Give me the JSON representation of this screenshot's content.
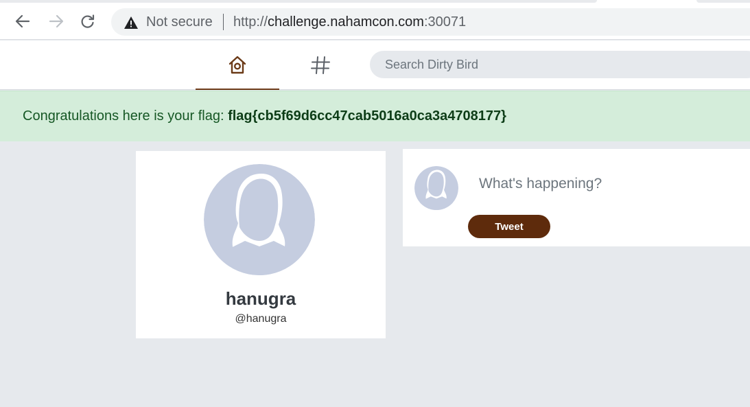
{
  "browser": {
    "security_label": "Not secure",
    "url_scheme": "http://",
    "url_host": "challenge.nahamcon.com",
    "url_port": ":30071",
    "icons": {
      "back": "back-arrow-icon",
      "forward": "forward-arrow-icon",
      "reload": "reload-icon",
      "warning": "warning-triangle-icon"
    }
  },
  "appbar": {
    "nav": [
      {
        "name": "home",
        "icon": "birdhouse-icon",
        "active": true
      },
      {
        "name": "tags",
        "icon": "hashtag-icon",
        "active": false
      }
    ],
    "search_placeholder": "Search Dirty Bird"
  },
  "flash": {
    "text": "Congratulations here is your flag: ",
    "flag": "flag{cb5f69d6cc47cab5016a0ca3a4708177}"
  },
  "profile": {
    "name": "hanugra",
    "handle": "@hanugra"
  },
  "composer": {
    "placeholder": "What's happening?",
    "button_label": "Tweet"
  },
  "colors": {
    "brand": "#5e2b0c",
    "flash_bg": "#d4edda",
    "page_bg": "#e6e9ed",
    "avatar_fill": "#c5cde0"
  }
}
